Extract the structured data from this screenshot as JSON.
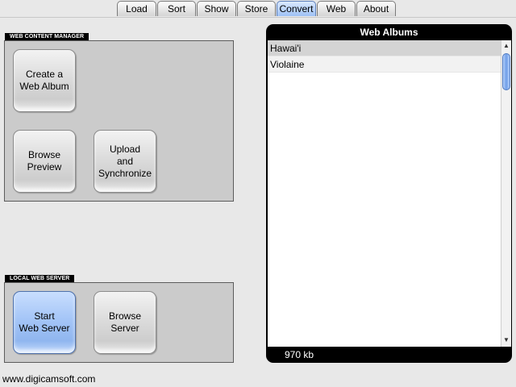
{
  "tabs": [
    "Load",
    "Sort",
    "Show",
    "Store",
    "Convert",
    "Web",
    "About"
  ],
  "active_tab": "Convert",
  "web_content_manager": {
    "label": "WEB CONTENT MANAGER",
    "create_album": "Create a\nWeb Album",
    "browse_preview": "Browse\nPreview",
    "upload_sync": "Upload\nand\nSynchronize"
  },
  "local_web_server": {
    "label": "LOCAL WEB SERVER",
    "start_server": "Start\nWeb Server",
    "browse_server": "Browse\nServer"
  },
  "web_albums": {
    "title": "Web Albums",
    "items": [
      "Hawai'i",
      "Violaine"
    ],
    "selected": "Hawai'i",
    "size": "970 kb"
  },
  "footer": {
    "website": "www.digicamsoft.com"
  },
  "colors": {
    "active_tab": "#9ec1f4",
    "highlight_button": "#a4c5f7",
    "panel": "#cbcbcb",
    "background": "#e8e8e8"
  }
}
